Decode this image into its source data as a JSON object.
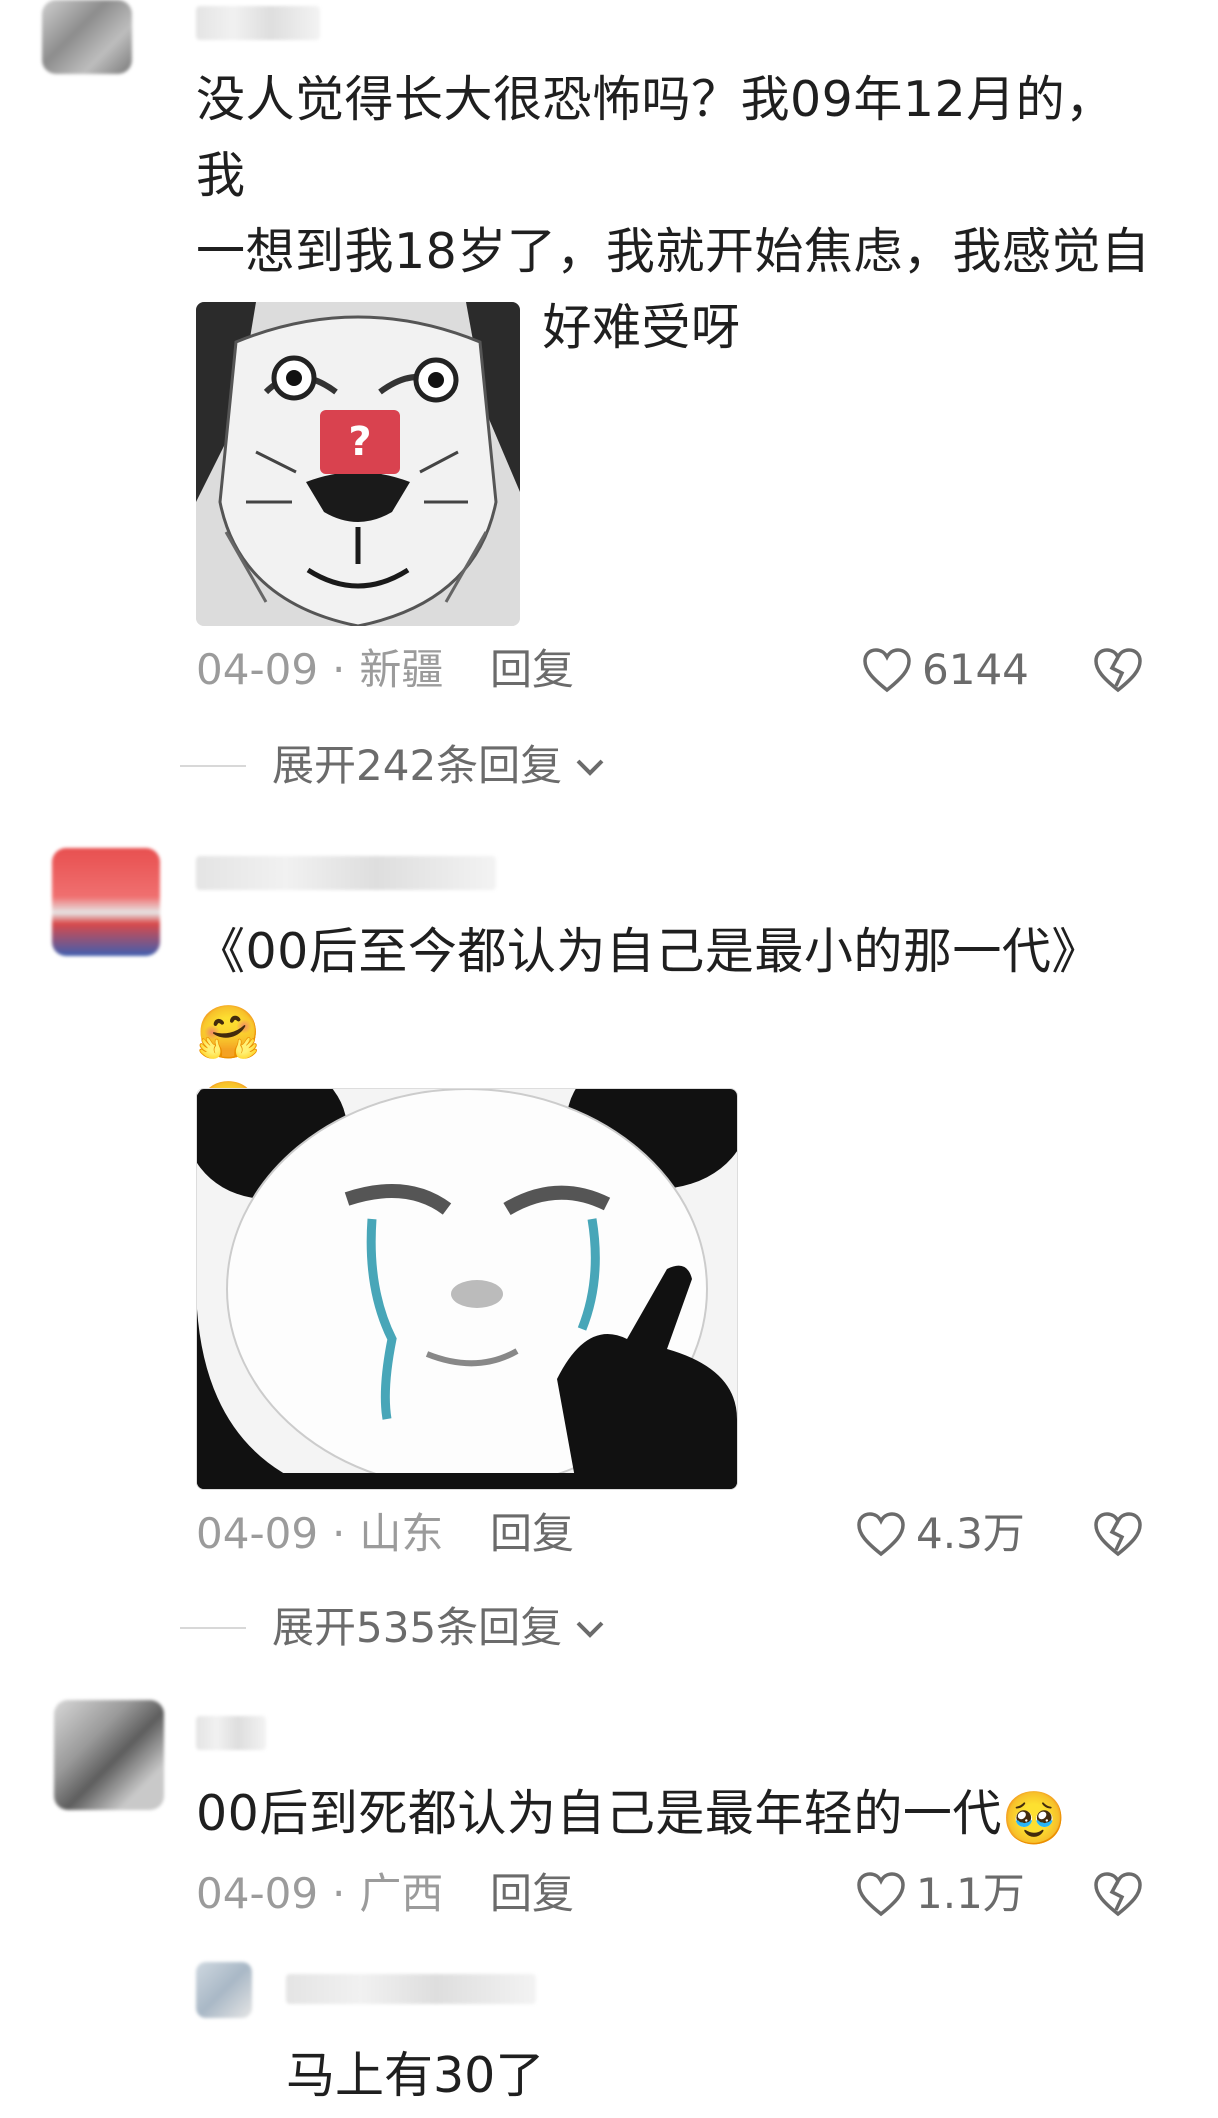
{
  "comments": [
    {
      "text": "没人觉得长大很恐怖吗？我09年12月的，我一想到我18岁了，我就开始焦虑，我感觉自己不是小孩了，好难受呀",
      "lines": [
        "没人觉得长大很恐怖吗？我09年12月的，我",
        "一想到我18岁了，我就开始焦虑，我感觉自",
        "己不是小孩了，好难受呀"
      ],
      "date": "04-09",
      "location": "新疆",
      "reply_label": "回复",
      "likes": "6144",
      "expand_label": "展开242条回复"
    },
    {
      "text": "《00后至今都认为自己是最小的那一代》",
      "emoji": "🤗",
      "date": "04-09",
      "location": "山东",
      "reply_label": "回复",
      "likes": "4.3万",
      "expand_label": "展开535条回复"
    },
    {
      "text": "00后到死都认为自己是最年轻的一代",
      "emoji": "🥹",
      "date": "04-09",
      "location": "广西",
      "reply_label": "回复",
      "likes": "1.1万"
    }
  ],
  "sub_reply": {
    "text": "马上有30了"
  },
  "separator": "·",
  "icons": {
    "like": "heart-outline-icon",
    "dislike": "broken-heart-icon",
    "expand": "chevron-down-icon",
    "broken_image": "broken-image-icon"
  },
  "colors": {
    "meta": "#9b9b9b",
    "action": "#6b6b6b",
    "badge": "#d9424f"
  }
}
